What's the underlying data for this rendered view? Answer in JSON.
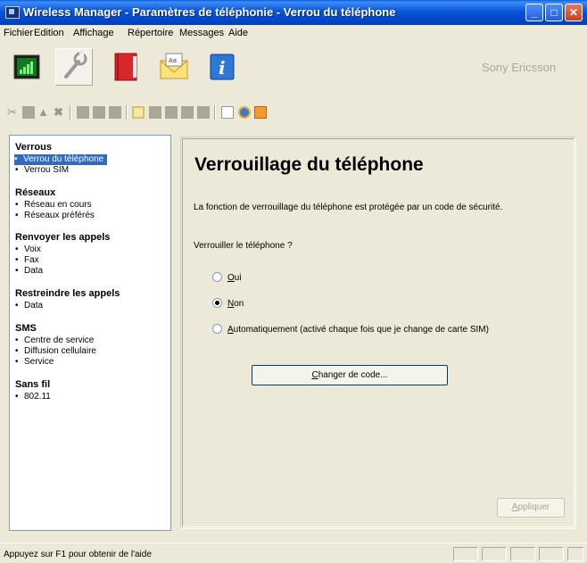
{
  "window": {
    "title": "Wireless Manager - Paramètres de téléphonie - Verrou du téléphone",
    "accent": "#0a55d8"
  },
  "menu": [
    "Fichier",
    "Edition",
    "Affichage",
    "Répertoire",
    "Messages",
    "Aide"
  ],
  "toolbar": {
    "brand": "Sony Ericsson",
    "big_buttons": [
      "signal-icon",
      "settings-wrench-icon",
      "phonebook-icon",
      "messages-envelope-icon",
      "info-icon"
    ]
  },
  "sidebar": {
    "sections": [
      {
        "title": "Verrous",
        "items": [
          "Verrou du téléphone",
          "Verrou SIM"
        ]
      },
      {
        "title": "Réseaux",
        "items": [
          "Réseau en cours",
          "Réseaux préférés"
        ]
      },
      {
        "title": "Renvoyer les appels",
        "items": [
          "Voix",
          "Fax",
          "Data"
        ]
      },
      {
        "title": "Restreindre les appels",
        "items": [
          "Data"
        ]
      },
      {
        "title": "SMS",
        "items": [
          "Centre de service",
          "Diffusion cellulaire",
          "Service"
        ]
      },
      {
        "title": "Sans fil",
        "items": [
          "802.11"
        ]
      }
    ],
    "selected": "Verrou du téléphone",
    "bullet": "•"
  },
  "main": {
    "heading": "Verrouillage du téléphone",
    "description": "La fonction de verrouillage du téléphone est protégée par un code de sécurité.",
    "question": "Verrouiller le téléphone ?",
    "options": [
      {
        "mnemonic": "O",
        "rest": "ui",
        "selected": false
      },
      {
        "mnemonic": "N",
        "rest": "on",
        "selected": true
      },
      {
        "mnemonic": "A",
        "rest": "utomatiquement (activé chaque fois que je change de carte SIM)",
        "selected": false
      }
    ],
    "change_button": {
      "mnemonic": "C",
      "rest": "hanger de code..."
    },
    "apply_button": {
      "mnemonic": "A",
      "rest": "ppliquer",
      "disabled": true
    }
  },
  "status": {
    "text": "Appuyez sur F1 pour obtenir de l'aide"
  }
}
